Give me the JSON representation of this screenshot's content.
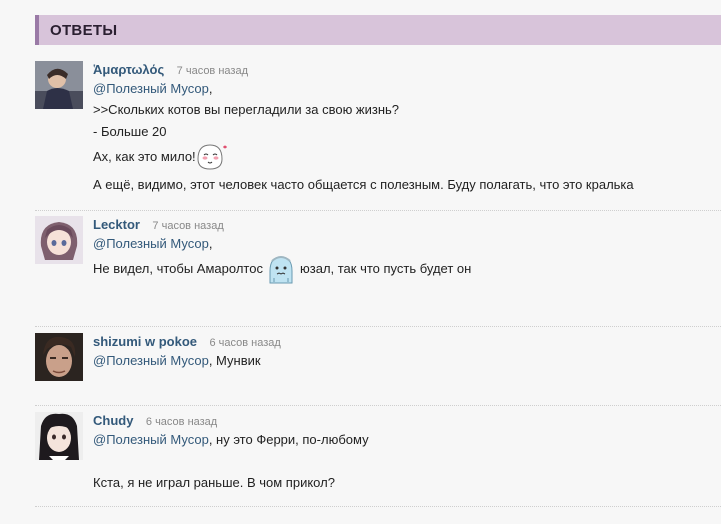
{
  "section": {
    "title": "ОТВЕТЫ"
  },
  "colors": {
    "header_bg": "#d8c4da",
    "header_accent": "#9a7aa6",
    "author": "#33597a",
    "mention": "#33597a"
  },
  "comments": [
    {
      "author": "Ἁμαρτωλός",
      "time": "7 часов назад",
      "mention": "@Полезный Мусор",
      "mention_suffix": ",",
      "lines": [
        ">>Скольких котов вы перегладили за свою жизнь?",
        "- Больше 20",
        "Ах, как это мило!",
        "А ещё, видимо, этот человек часто общается с полезным. Буду полагать, что это кралька"
      ],
      "emoji": "blushing-smiley-icon"
    },
    {
      "author": "Lecktor",
      "time": "7 часов назад",
      "mention": "@Полезный Мусор",
      "mention_suffix": ",",
      "line_before_emoji": "Не видел, чтобы Амаролтос",
      "line_after_emoji": "юзал, так что пусть будет он",
      "emoji": "cold-smiley-icon"
    },
    {
      "author": "shizumi w pokoe",
      "time": "6 часов назад",
      "mention": "@Полезный Мусор",
      "mention_suffix": ", Мунвик"
    },
    {
      "author": "Chudy",
      "time": "6 часов назад",
      "mention": "@Полезный Мусор",
      "mention_suffix": ", ну это Ферри, по-любому",
      "lines": [
        "Кста, я не играл раньше. В чом прикол?"
      ]
    }
  ]
}
